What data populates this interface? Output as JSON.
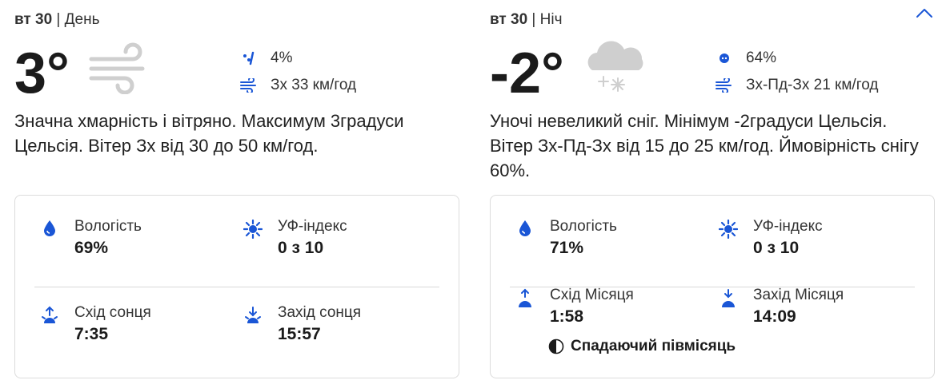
{
  "day": {
    "date": "вт 30",
    "sep": " | ",
    "period": "День",
    "temp": "3°",
    "condition_icon": "wind-icon",
    "precip": "4%",
    "wind": "Зх 33 км/год",
    "summary": "Значна хмарність і вітряно. Максимум 3градуси Цельсія. Вітер Зх від 30 до 50 км/год.",
    "details": {
      "humidity_label": "Вологість",
      "humidity_value": "69%",
      "uv_label": "УФ-індекс",
      "uv_value": "0 з 10",
      "rise_label": "Схід сонця",
      "rise_value": "7:35",
      "set_label": "Захід сонця",
      "set_value": "15:57"
    }
  },
  "night": {
    "date": "вт 30",
    "sep": " | ",
    "period": "Ніч",
    "temp": "-2°",
    "condition_icon": "cloud-snow-icon",
    "precip": "64%",
    "wind": "Зх-Пд-Зх 21 км/год",
    "summary": "Уночі невеликий сніг. Мінімум -2градуси Цельсія. Вітер Зх-Пд-Зх від 15 до 25 км/год. Ймовірність снігу 60%.",
    "details": {
      "humidity_label": "Вологість",
      "humidity_value": "71%",
      "uv_label": "УФ-індекс",
      "uv_value": "0 з 10",
      "rise_label": "Схід Місяця",
      "rise_value": "1:58",
      "set_label": "Захід Місяця",
      "set_value": "14:09",
      "moon_phase": "Спадаючий півмісяць"
    }
  },
  "colors": {
    "accent": "#1a56d6",
    "text": "#1b1b1b",
    "border": "#dcdcdc"
  }
}
